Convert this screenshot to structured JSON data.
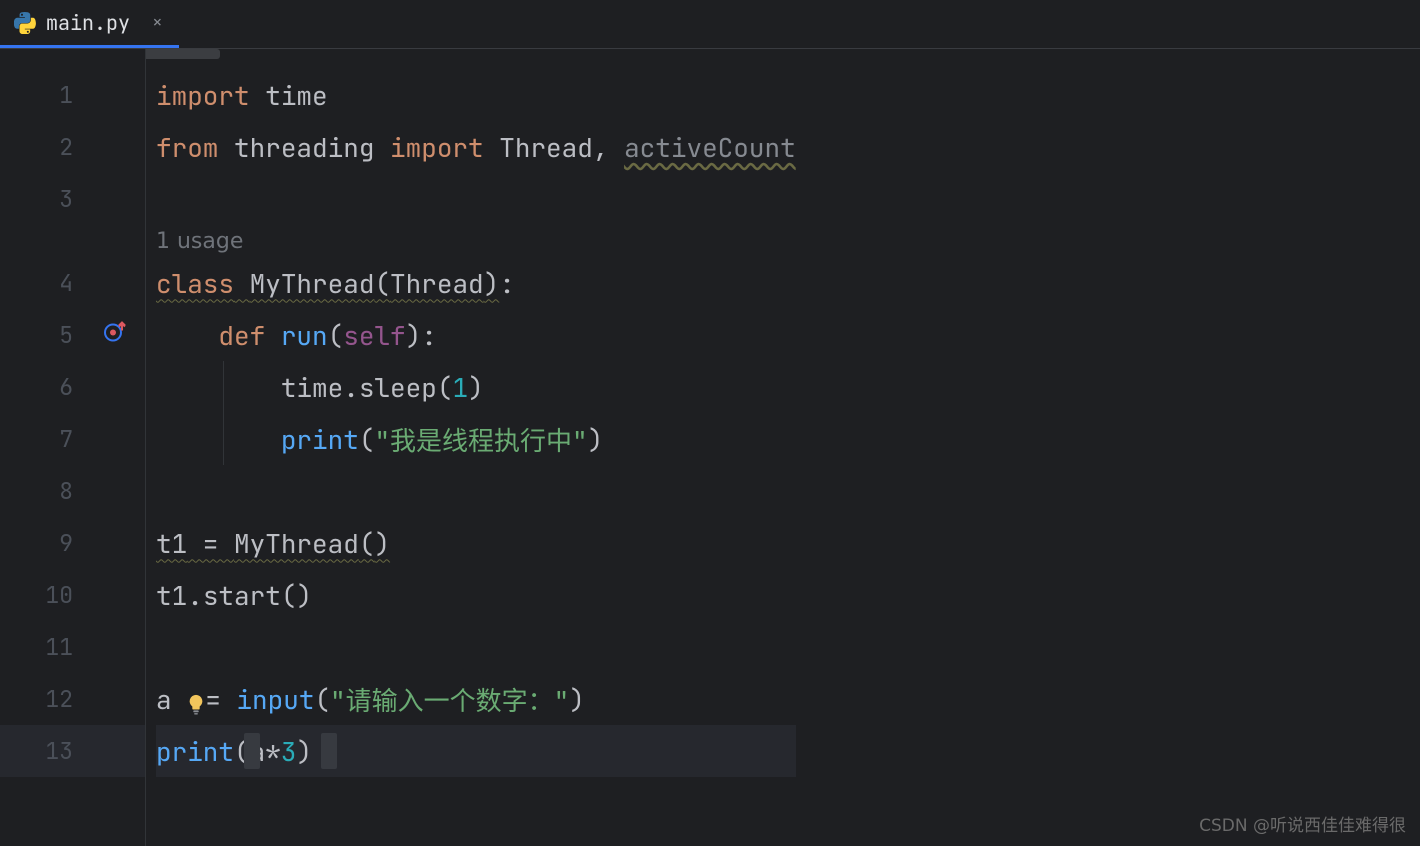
{
  "tab": {
    "filename": "main.py",
    "close_glyph": "×"
  },
  "gutter": {
    "line_numbers": [
      "1",
      "2",
      "3",
      "4",
      "5",
      "6",
      "7",
      "8",
      "9",
      "10",
      "11",
      "12",
      "13"
    ],
    "run_marker_line": 5
  },
  "current_line": 13,
  "hints": {
    "usage": "1 usage"
  },
  "tokens": {
    "import_kw": "import",
    "from_kw": "from",
    "class_kw": "class",
    "def_kw": "def",
    "time_mod": "time",
    "threading_mod": "threading",
    "Thread_cls": "Thread",
    "activeCount": "activeCount",
    "MyThread": "MyThread",
    "run_fn": "run",
    "self_kw": "self",
    "sleep_fn": "sleep",
    "print_fn": "print",
    "input_fn": "input",
    "start_fn": "start",
    "t1_var": "t1",
    "a_var": "a",
    "num_1": "1",
    "num_3": "3",
    "str_thread": "\"我是线程执行中\"",
    "str_prompt": "\"请输入一个数字：\"",
    "comma_sp": ", ",
    "colon": ":",
    "lpar": "(",
    "rpar": ")",
    "dot": ".",
    "eq": " = ",
    "star": "*",
    "space": " ",
    "eq_only": "= "
  },
  "watermark": "CSDN @听说西佳佳难得很"
}
